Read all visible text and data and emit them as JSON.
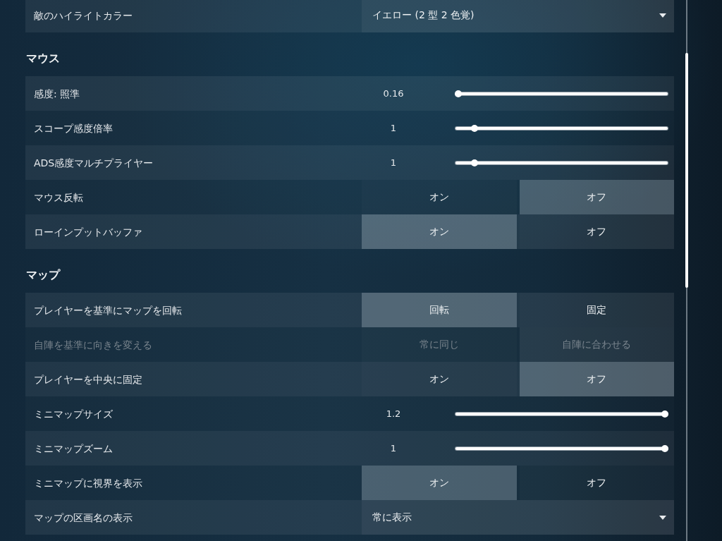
{
  "sections": [
    {
      "rows": [
        {
          "kind": "dropdown",
          "label": "敵のハイライトカラー",
          "value": "イエロー (2 型 2 色覚)",
          "disabled": false
        }
      ]
    },
    {
      "title": "マウス",
      "rows": [
        {
          "kind": "slider",
          "label": "感度: 照準",
          "reading": "0.16",
          "level": 0.0,
          "disabled": false
        },
        {
          "kind": "slider",
          "label": "スコープ感度倍率",
          "reading": "1",
          "level": 0.08,
          "disabled": false
        },
        {
          "kind": "slider",
          "label": "ADS感度マルチプライヤー",
          "reading": "1",
          "level": 0.08,
          "disabled": false
        },
        {
          "kind": "toggle",
          "label": "マウス反転",
          "disabled": false,
          "options": [
            {
              "label": "オン",
              "selected": false
            },
            {
              "label": "オフ",
              "selected": true
            }
          ]
        },
        {
          "kind": "toggle",
          "label": "ローインプットバッファ",
          "disabled": false,
          "options": [
            {
              "label": "オン",
              "selected": true
            },
            {
              "label": "オフ",
              "selected": false
            }
          ]
        }
      ]
    },
    {
      "title": "マップ",
      "rows": [
        {
          "kind": "toggle",
          "label": "プレイヤーを基準にマップを回転",
          "disabled": false,
          "options": [
            {
              "label": "回転",
              "selected": true
            },
            {
              "label": "固定",
              "selected": false
            }
          ]
        },
        {
          "kind": "toggle",
          "label": "自陣を基準に向きを変える",
          "disabled": true,
          "options": [
            {
              "label": "常に同じ",
              "selected": false
            },
            {
              "label": "自陣に合わせる",
              "selected": true
            }
          ]
        },
        {
          "kind": "toggle",
          "label": "プレイヤーを中央に固定",
          "disabled": false,
          "options": [
            {
              "label": "オン",
              "selected": false
            },
            {
              "label": "オフ",
              "selected": true
            }
          ]
        },
        {
          "kind": "slider",
          "label": "ミニマップサイズ",
          "reading": "1.2",
          "level": 1.0,
          "disabled": false
        },
        {
          "kind": "slider",
          "label": "ミニマップズーム",
          "reading": "1",
          "level": 1.0,
          "disabled": false
        },
        {
          "kind": "toggle",
          "label": "ミニマップに視界を表示",
          "disabled": false,
          "options": [
            {
              "label": "オン",
              "selected": true
            },
            {
              "label": "オフ",
              "selected": false
            }
          ]
        },
        {
          "kind": "dropdown",
          "label": "マップの区画名の表示",
          "value": "常に表示",
          "disabled": false
        }
      ]
    }
  ]
}
